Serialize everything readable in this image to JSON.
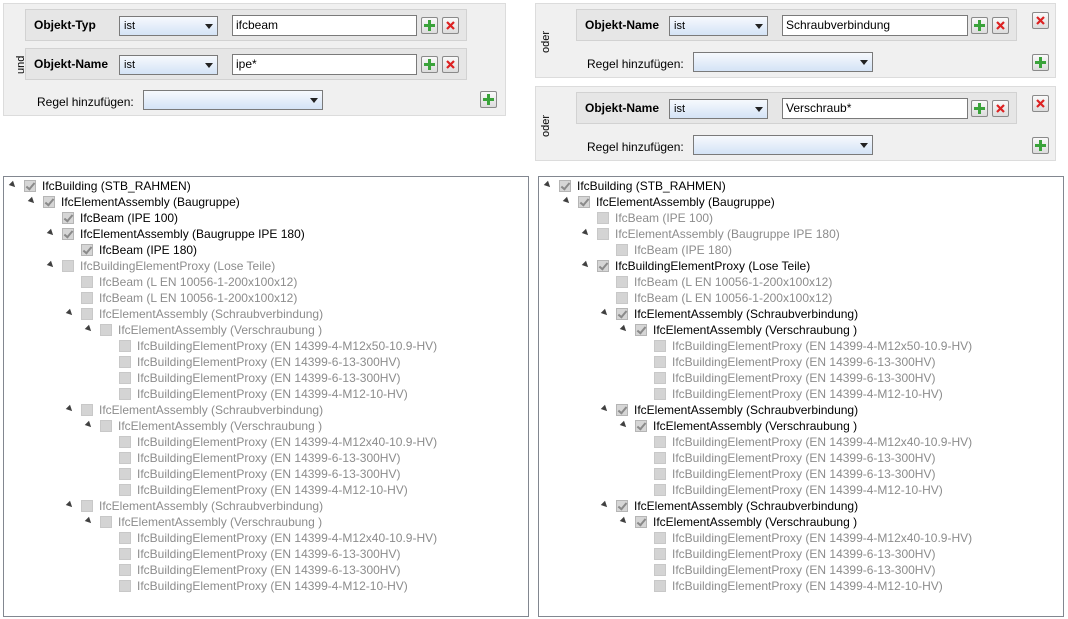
{
  "left_filter": {
    "rule1": {
      "label": "Objekt-Typ",
      "operator": "ist",
      "value": "ifcbeam"
    },
    "connector": "und",
    "rule2": {
      "label": "Objekt-Name",
      "operator": "ist",
      "value": "ipe*"
    },
    "add_rule_label": "Regel hinzufügen:",
    "add_rule_value": ""
  },
  "right_filter_top": {
    "connector": "oder",
    "rule": {
      "label": "Objekt-Name",
      "operator": "ist",
      "value": "Schraubverbindung"
    },
    "add_rule_label": "Regel hinzufügen:",
    "add_rule_value": ""
  },
  "right_filter_bottom": {
    "connector": "oder",
    "rule": {
      "label": "Objekt-Name",
      "operator": "ist",
      "value": "Verschraub*"
    },
    "add_rule_label": "Regel hinzufügen:",
    "add_rule_value": ""
  },
  "left_tree": [
    {
      "text": "IfcBuilding (STB_RAHMEN)",
      "level": 0,
      "exp": true,
      "checked": true,
      "dim": false
    },
    {
      "text": "IfcElementAssembly (Baugruppe)",
      "level": 1,
      "exp": true,
      "checked": true,
      "dim": false
    },
    {
      "text": "IfcBeam (IPE 100)",
      "level": 2,
      "exp": false,
      "checked": true,
      "dim": false
    },
    {
      "text": "IfcElementAssembly (Baugruppe IPE 180)",
      "level": 2,
      "exp": true,
      "checked": true,
      "dim": false
    },
    {
      "text": "IfcBeam (IPE 180)",
      "level": 3,
      "exp": false,
      "checked": true,
      "dim": false
    },
    {
      "text": "IfcBuildingElementProxy (Lose Teile)",
      "level": 2,
      "exp": true,
      "checked": false,
      "dim": true
    },
    {
      "text": "IfcBeam (L EN 10056-1-200x100x12)",
      "level": 3,
      "exp": false,
      "checked": false,
      "dim": true
    },
    {
      "text": "IfcBeam (L EN 10056-1-200x100x12)",
      "level": 3,
      "exp": false,
      "checked": false,
      "dim": true
    },
    {
      "text": "IfcElementAssembly (Schraubverbindung)",
      "level": 3,
      "exp": true,
      "checked": false,
      "dim": true
    },
    {
      "text": "IfcElementAssembly (Verschraubung )",
      "level": 4,
      "exp": true,
      "checked": false,
      "dim": true
    },
    {
      "text": "IfcBuildingElementProxy (EN 14399-4-M12x50-10.9-HV)",
      "level": 5,
      "exp": false,
      "checked": false,
      "dim": true
    },
    {
      "text": "IfcBuildingElementProxy (EN 14399-6-13-300HV)",
      "level": 5,
      "exp": false,
      "checked": false,
      "dim": true
    },
    {
      "text": "IfcBuildingElementProxy (EN 14399-6-13-300HV)",
      "level": 5,
      "exp": false,
      "checked": false,
      "dim": true
    },
    {
      "text": "IfcBuildingElementProxy (EN 14399-4-M12-10-HV)",
      "level": 5,
      "exp": false,
      "checked": false,
      "dim": true
    },
    {
      "text": "IfcElementAssembly (Schraubverbindung)",
      "level": 3,
      "exp": true,
      "checked": false,
      "dim": true
    },
    {
      "text": "IfcElementAssembly (Verschraubung )",
      "level": 4,
      "exp": true,
      "checked": false,
      "dim": true
    },
    {
      "text": "IfcBuildingElementProxy (EN 14399-4-M12x40-10.9-HV)",
      "level": 5,
      "exp": false,
      "checked": false,
      "dim": true
    },
    {
      "text": "IfcBuildingElementProxy (EN 14399-6-13-300HV)",
      "level": 5,
      "exp": false,
      "checked": false,
      "dim": true
    },
    {
      "text": "IfcBuildingElementProxy (EN 14399-6-13-300HV)",
      "level": 5,
      "exp": false,
      "checked": false,
      "dim": true
    },
    {
      "text": "IfcBuildingElementProxy (EN 14399-4-M12-10-HV)",
      "level": 5,
      "exp": false,
      "checked": false,
      "dim": true
    },
    {
      "text": "IfcElementAssembly (Schraubverbindung)",
      "level": 3,
      "exp": true,
      "checked": false,
      "dim": true
    },
    {
      "text": "IfcElementAssembly (Verschraubung )",
      "level": 4,
      "exp": true,
      "checked": false,
      "dim": true
    },
    {
      "text": "IfcBuildingElementProxy (EN 14399-4-M12x40-10.9-HV)",
      "level": 5,
      "exp": false,
      "checked": false,
      "dim": true
    },
    {
      "text": "IfcBuildingElementProxy (EN 14399-6-13-300HV)",
      "level": 5,
      "exp": false,
      "checked": false,
      "dim": true
    },
    {
      "text": "IfcBuildingElementProxy (EN 14399-6-13-300HV)",
      "level": 5,
      "exp": false,
      "checked": false,
      "dim": true
    },
    {
      "text": "IfcBuildingElementProxy (EN 14399-4-M12-10-HV)",
      "level": 5,
      "exp": false,
      "checked": false,
      "dim": true
    }
  ],
  "right_tree": [
    {
      "text": "IfcBuilding (STB_RAHMEN)",
      "level": 0,
      "exp": true,
      "checked": true,
      "dim": false
    },
    {
      "text": "IfcElementAssembly (Baugruppe)",
      "level": 1,
      "exp": true,
      "checked": true,
      "dim": false
    },
    {
      "text": "IfcBeam (IPE 100)",
      "level": 2,
      "exp": false,
      "checked": false,
      "dim": true
    },
    {
      "text": "IfcElementAssembly (Baugruppe IPE 180)",
      "level": 2,
      "exp": true,
      "checked": false,
      "dim": true
    },
    {
      "text": "IfcBeam (IPE 180)",
      "level": 3,
      "exp": false,
      "checked": false,
      "dim": true
    },
    {
      "text": "IfcBuildingElementProxy (Lose Teile)",
      "level": 2,
      "exp": true,
      "checked": true,
      "dim": false
    },
    {
      "text": "IfcBeam (L EN 10056-1-200x100x12)",
      "level": 3,
      "exp": false,
      "checked": false,
      "dim": true
    },
    {
      "text": "IfcBeam (L EN 10056-1-200x100x12)",
      "level": 3,
      "exp": false,
      "checked": false,
      "dim": true
    },
    {
      "text": "IfcElementAssembly (Schraubverbindung)",
      "level": 3,
      "exp": true,
      "checked": true,
      "dim": false
    },
    {
      "text": "IfcElementAssembly (Verschraubung )",
      "level": 4,
      "exp": true,
      "checked": true,
      "dim": false
    },
    {
      "text": "IfcBuildingElementProxy (EN 14399-4-M12x50-10.9-HV)",
      "level": 5,
      "exp": false,
      "checked": false,
      "dim": true
    },
    {
      "text": "IfcBuildingElementProxy (EN 14399-6-13-300HV)",
      "level": 5,
      "exp": false,
      "checked": false,
      "dim": true
    },
    {
      "text": "IfcBuildingElementProxy (EN 14399-6-13-300HV)",
      "level": 5,
      "exp": false,
      "checked": false,
      "dim": true
    },
    {
      "text": "IfcBuildingElementProxy (EN 14399-4-M12-10-HV)",
      "level": 5,
      "exp": false,
      "checked": false,
      "dim": true
    },
    {
      "text": "IfcElementAssembly (Schraubverbindung)",
      "level": 3,
      "exp": true,
      "checked": true,
      "dim": false
    },
    {
      "text": "IfcElementAssembly (Verschraubung )",
      "level": 4,
      "exp": true,
      "checked": true,
      "dim": false
    },
    {
      "text": "IfcBuildingElementProxy (EN 14399-4-M12x40-10.9-HV)",
      "level": 5,
      "exp": false,
      "checked": false,
      "dim": true
    },
    {
      "text": "IfcBuildingElementProxy (EN 14399-6-13-300HV)",
      "level": 5,
      "exp": false,
      "checked": false,
      "dim": true
    },
    {
      "text": "IfcBuildingElementProxy (EN 14399-6-13-300HV)",
      "level": 5,
      "exp": false,
      "checked": false,
      "dim": true
    },
    {
      "text": "IfcBuildingElementProxy (EN 14399-4-M12-10-HV)",
      "level": 5,
      "exp": false,
      "checked": false,
      "dim": true
    },
    {
      "text": "IfcElementAssembly (Schraubverbindung)",
      "level": 3,
      "exp": true,
      "checked": true,
      "dim": false
    },
    {
      "text": "IfcElementAssembly (Verschraubung )",
      "level": 4,
      "exp": true,
      "checked": true,
      "dim": false
    },
    {
      "text": "IfcBuildingElementProxy (EN 14399-4-M12x40-10.9-HV)",
      "level": 5,
      "exp": false,
      "checked": false,
      "dim": true
    },
    {
      "text": "IfcBuildingElementProxy (EN 14399-6-13-300HV)",
      "level": 5,
      "exp": false,
      "checked": false,
      "dim": true
    },
    {
      "text": "IfcBuildingElementProxy (EN 14399-6-13-300HV)",
      "level": 5,
      "exp": false,
      "checked": false,
      "dim": true
    },
    {
      "text": "IfcBuildingElementProxy (EN 14399-4-M12-10-HV)",
      "level": 5,
      "exp": false,
      "checked": false,
      "dim": true
    }
  ]
}
